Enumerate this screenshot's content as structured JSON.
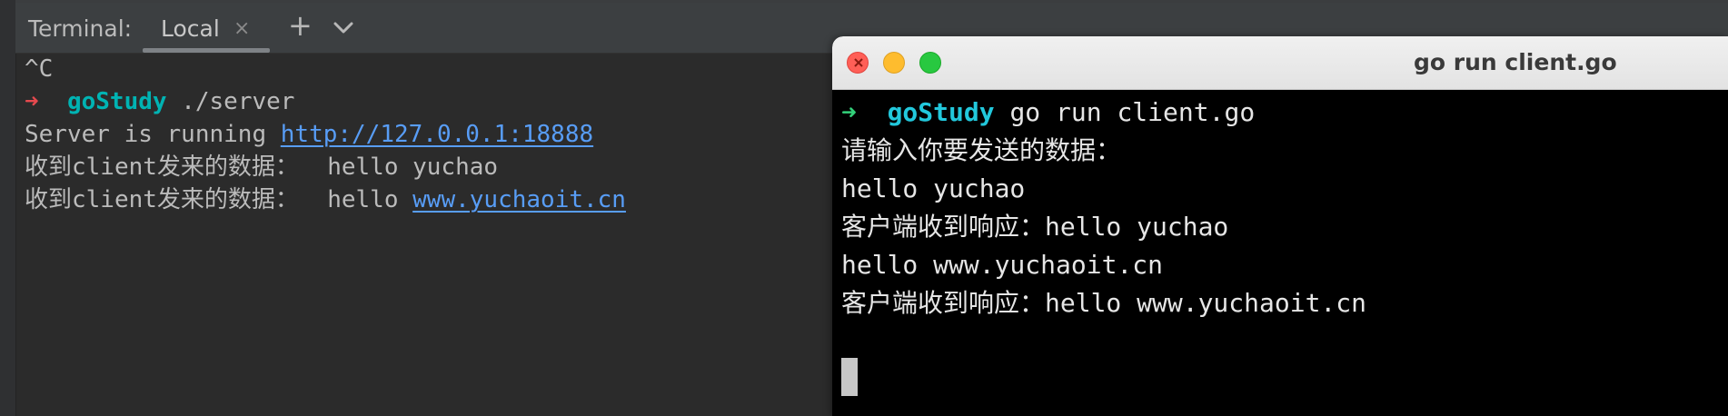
{
  "ide": {
    "panel_title": "Terminal:",
    "tab": {
      "label": "Local",
      "close_glyph": "×"
    },
    "add_glyph": "+",
    "lines": {
      "l0": "^C",
      "l1_arrow": "➜",
      "l1_dir": "goStudy",
      "l1_cmd": " ./server",
      "l2_text": "Server is running ",
      "l2_link": "http://127.0.0.1:18888",
      "l3_text": "收到client发来的数据：  hello yuchao",
      "l4_text": "收到client发来的数据：  hello ",
      "l4_link": "www.yuchaoit.cn"
    }
  },
  "terminal_window": {
    "title": "go run client.go",
    "lines": {
      "t1_arrow": "➜",
      "t1_dir": "goStudy",
      "t1_cmd": " go run client.go",
      "t2": "请输入你要发送的数据：",
      "t3": "hello yuchao",
      "t4": "客户端收到响应：hello yuchao",
      "t5": "hello www.yuchaoit.cn",
      "t6": "客户端收到响应：hello www.yuchaoit.cn"
    }
  },
  "icons": {
    "tab_menu": "chevron-down-icon",
    "add": "plus-icon",
    "close": "close-icon"
  },
  "colors": {
    "ide_bg": "#2b2b2b",
    "link": "#589df6",
    "prompt_arrow_ide": "#e6494e",
    "prompt_dir_ide": "#00b3b3",
    "prompt_arrow_term": "#33d17a",
    "prompt_dir_term": "#22c8dc"
  }
}
